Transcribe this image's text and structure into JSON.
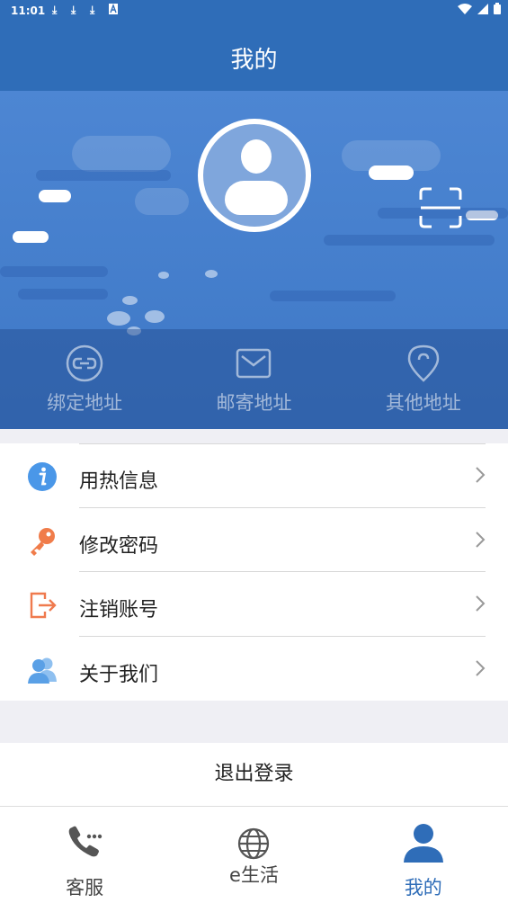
{
  "status_bar": {
    "time": "11:01",
    "download_icons": [
      "download-icon",
      "download-icon",
      "download-icon"
    ],
    "extra_icon": "a-icon",
    "right_icons": [
      "wifi-icon",
      "signal-icon",
      "battery-icon"
    ]
  },
  "header": {
    "title": "我的"
  },
  "hero": {
    "avatar_icon": "user-avatar-icon",
    "scan_icon": "scan-icon",
    "quick_actions": [
      {
        "label": "绑定地址",
        "icon": "link-icon"
      },
      {
        "label": "邮寄地址",
        "icon": "mail-icon"
      },
      {
        "label": "其他地址",
        "icon": "location-pin-icon"
      }
    ]
  },
  "menu": {
    "items": [
      {
        "label": "用热信息",
        "icon": "info-icon"
      },
      {
        "label": "修改密码",
        "icon": "key-icon"
      },
      {
        "label": "注销账号",
        "icon": "exit-icon"
      },
      {
        "label": "关于我们",
        "icon": "people-icon"
      }
    ]
  },
  "logout": {
    "label": "退出登录"
  },
  "tabbar": {
    "tabs": [
      {
        "label": "客服",
        "icon": "phone-icon"
      },
      {
        "label": "e生活",
        "icon": "globe-icon"
      },
      {
        "label": "我的",
        "icon": "user-icon"
      }
    ],
    "active_index": 2
  },
  "colors": {
    "primary": "#2f6db8",
    "info_blue": "#4a97e8",
    "key_orange": "#f07c4a",
    "exit_orange": "#ef7a4e",
    "people_blue": "#5aa0e6"
  }
}
